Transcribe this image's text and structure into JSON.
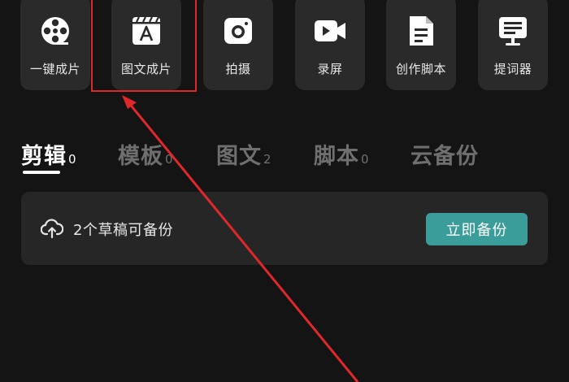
{
  "tools": [
    {
      "label": "一键成片",
      "icon": "film-reel-icon"
    },
    {
      "label": "图文成片",
      "icon": "text-clapper-icon"
    },
    {
      "label": "拍摄",
      "icon": "camera-icon"
    },
    {
      "label": "录屏",
      "icon": "screen-record-icon"
    },
    {
      "label": "创作脚本",
      "icon": "script-document-icon"
    },
    {
      "label": "提词器",
      "icon": "teleprompter-icon"
    }
  ],
  "tabs": [
    {
      "label": "剪辑",
      "count": "0",
      "active": true
    },
    {
      "label": "模板",
      "count": "0",
      "active": false
    },
    {
      "label": "图文",
      "count": "2",
      "active": false
    },
    {
      "label": "脚本",
      "count": "0",
      "active": false
    },
    {
      "label": "云备份",
      "count": "",
      "active": false
    }
  ],
  "backup": {
    "message": "2个草稿可备份",
    "button_label": "立即备份",
    "icon": "cloud-upload-icon"
  },
  "colors": {
    "background": "#141414",
    "tile": "#2a2a2a",
    "card": "#262626",
    "accent": "#3a9d99",
    "annotation": "#e0282a"
  }
}
